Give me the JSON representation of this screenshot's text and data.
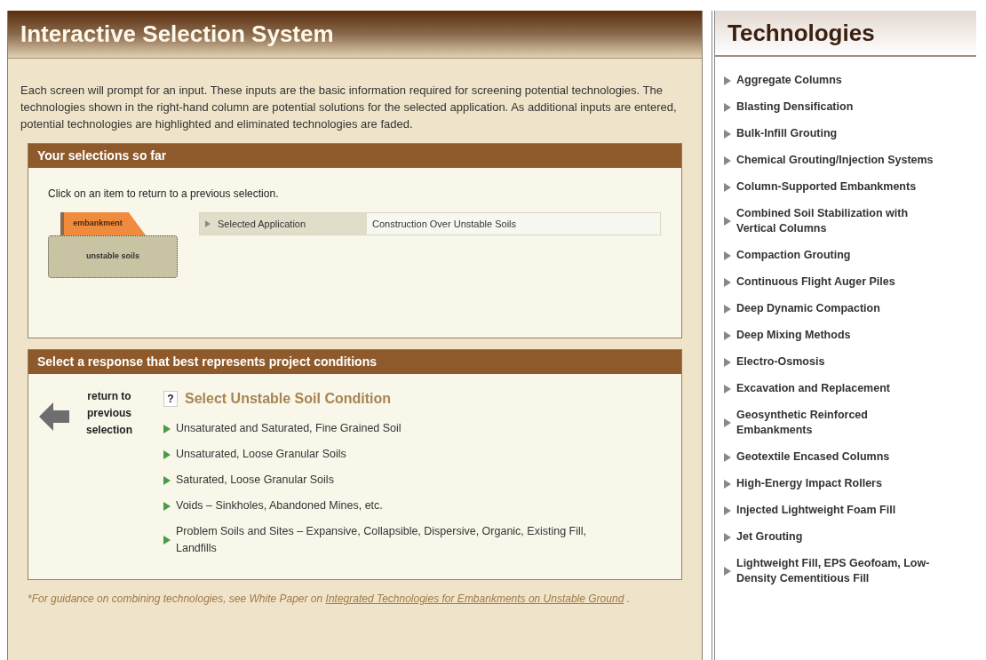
{
  "main": {
    "title": "Interactive Selection System",
    "intro": "Each screen will prompt for an input. These inputs are the basic information required for screening potential technologies. The technologies shown in the right-hand column are potential solutions for the selected application. As additional inputs are entered, potential technologies are highlighted and eliminated technologies are faded.",
    "selections": {
      "heading": "Your selections so far",
      "hint": "Click on an item to return to a previous selection.",
      "breadcrumbs": [
        {
          "kind": "tab",
          "label": "embankment"
        },
        {
          "kind": "current",
          "label": "unstable soils"
        }
      ],
      "rows": [
        {
          "label": "Selected Application",
          "value": "Construction Over Unstable Soils"
        }
      ]
    },
    "response": {
      "heading": "Select a response that best represents project conditions",
      "back": "return to previous selection",
      "help": "?",
      "question": "Select Unstable Soil Condition",
      "options": [
        "Unsaturated and Saturated, Fine Grained Soil",
        "Unsaturated, Loose Granular Soils",
        "Saturated, Loose Granular Soils",
        "Voids – Sinkholes, Abandoned Mines, etc.",
        "Problem Soils and Sites – Expansive, Collapsible, Dispersive, Organic, Existing Fill, Landfills"
      ]
    },
    "footnote": {
      "text": "*For guidance on combining technologies, see White Paper on",
      "link": "Integrated Technologies for Embankments on Unstable Ground",
      "end": "."
    }
  },
  "technologies": {
    "title": "Technologies",
    "items": [
      "Aggregate Columns",
      "Blasting Densification",
      "Bulk-Infill Grouting",
      "Chemical Grouting/Injection Systems",
      "Column-Supported Embankments",
      "Combined Soil Stabilization with Vertical Columns",
      "Compaction Grouting",
      "Continuous Flight Auger Piles",
      "Deep Dynamic Compaction",
      "Deep Mixing Methods",
      "Electro-Osmosis",
      "Excavation and Replacement",
      "Geosynthetic Reinforced Embankments",
      "Geotextile Encased Columns",
      "High-Energy Impact Rollers",
      "Injected Lightweight Foam Fill",
      "Jet Grouting",
      "Lightweight Fill, EPS Geofoam, Low-Density Cementitious Fill"
    ]
  }
}
